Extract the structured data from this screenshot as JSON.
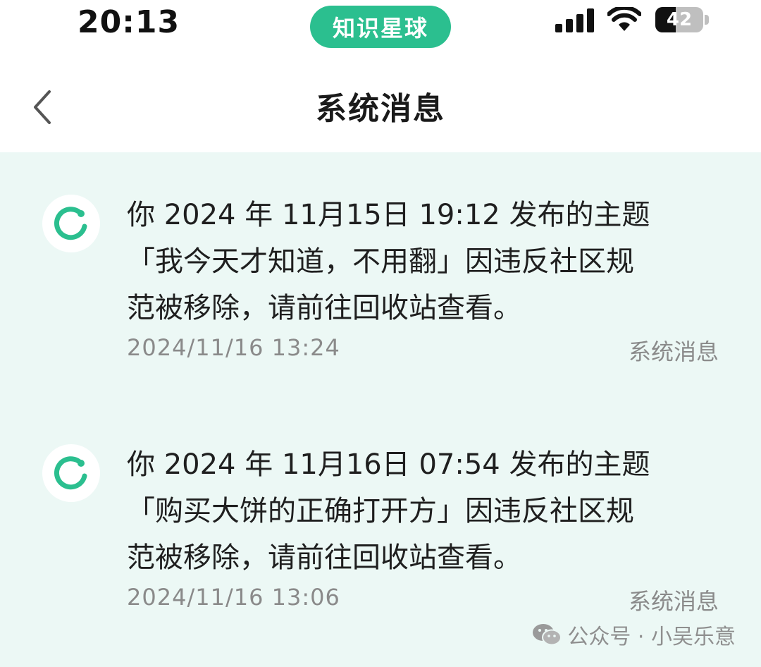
{
  "status_bar": {
    "time": "20:13",
    "app_pill": "知识星球",
    "battery_level": "42",
    "battery_fraction": 0.42
  },
  "nav": {
    "title": "系统消息",
    "back_icon": "chevron-left-icon"
  },
  "messages": [
    {
      "text": "你 2024 年 11月15日 19:12 发布的主题\n「我今天才知道，不用翻」因违反社区规\n范被移除，请前往回收站查看。",
      "time": "2024/11/16 13:24",
      "source": "系统消息",
      "icon": "system-logo-icon"
    },
    {
      "text": "你 2024 年 11月16日 07:54 发布的主题\n「购买大饼的正确打开方」因违反社区规\n范被移除，请前往回收站查看。",
      "time": "2024/11/16 13:06",
      "source": "系统消息",
      "icon": "system-logo-icon"
    }
  ],
  "watermark": {
    "text": "公众号 · 小吴乐意",
    "icon": "wechat-icon"
  },
  "colors": {
    "brand_green": "#2bbf8f",
    "list_background": "#ecf8f5",
    "secondary_text": "#8a8a8a"
  }
}
